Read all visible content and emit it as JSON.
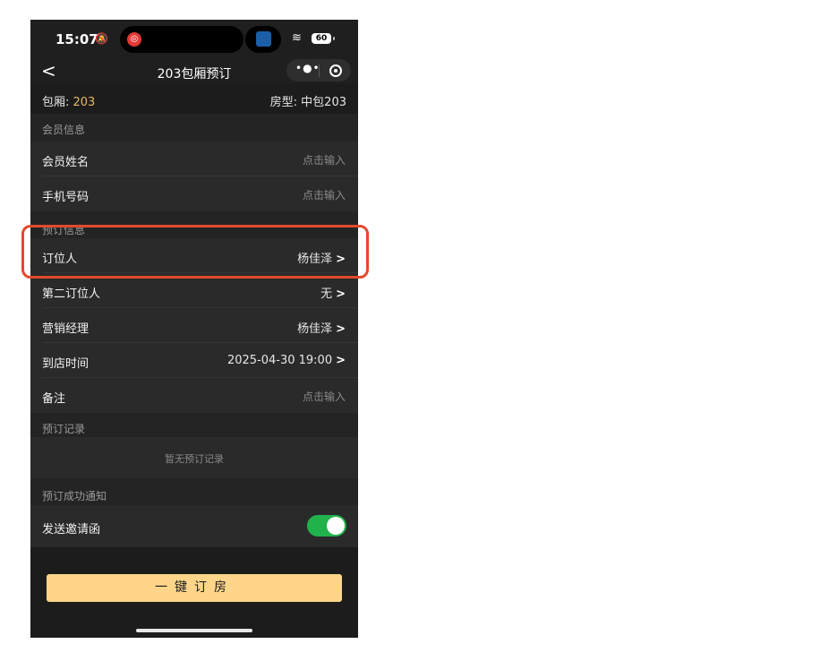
{
  "status_bar": {
    "time": "15:07",
    "battery": "60"
  },
  "nav": {
    "back": "<",
    "title": "203包厢预订",
    "more": "•●•"
  },
  "room": {
    "label": "包厢: ",
    "number": "203",
    "type": "房型: 中包203"
  },
  "sections": {
    "member": "会员信息",
    "booking": "预订信息",
    "records": "预订记录",
    "notify": "预订成功通知"
  },
  "member_rows": [
    {
      "label": "会员姓名",
      "value": "点击输入"
    },
    {
      "label": "手机号码",
      "value": "点击输入"
    }
  ],
  "booking_rows": [
    {
      "label": "订位人",
      "value": "杨佳泽"
    },
    {
      "label": "第二订位人",
      "value": "无"
    },
    {
      "label": "营销经理",
      "value": "杨佳泽"
    },
    {
      "label": "到店时间",
      "value": "2025-04-30 19:00"
    },
    {
      "label": "备注",
      "value": "点击输入"
    }
  ],
  "records_empty": "暂无预订记录",
  "notify": {
    "label": "发送邀请函",
    "enabled": true
  },
  "book_button": "一键订房",
  "colors": {
    "accent": "#ffd58a",
    "toggle_on": "#21b24b",
    "highlight": "#e24a2c",
    "room_number": "#e8b86a"
  }
}
